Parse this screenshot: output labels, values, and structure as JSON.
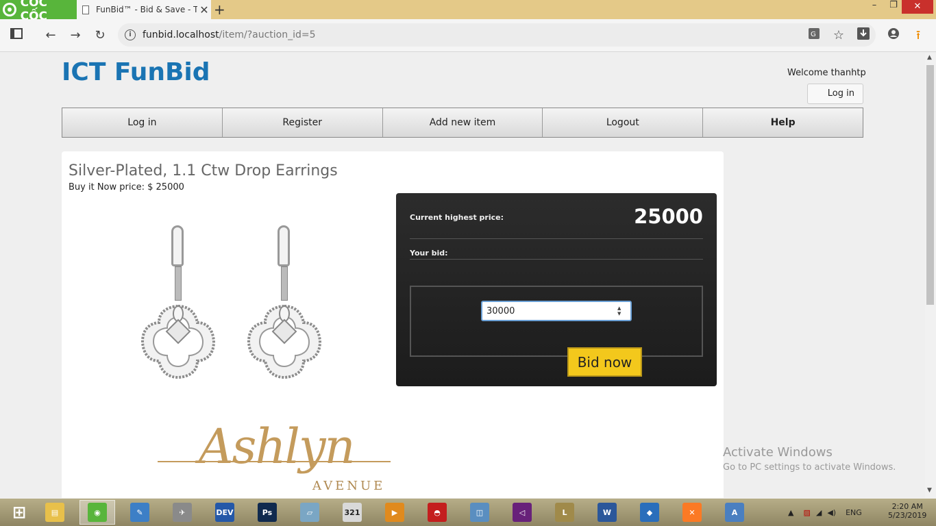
{
  "browser": {
    "brand": "CỐC CỐC",
    "tab_title": "FunBid™ - Bid & Save - Th",
    "tab_close": "✕",
    "new_tab": "+",
    "url_host": "funbid.localhost",
    "url_path": "/item/?auction_id=5",
    "window_controls": {
      "minimize": "–",
      "maximize": "❐",
      "close": "✕"
    }
  },
  "header": {
    "site_title": "ICT FunBid",
    "welcome": "Welcome thanhtp",
    "login_button": "Log in"
  },
  "nav": {
    "items": [
      {
        "label": "Log in"
      },
      {
        "label": "Register"
      },
      {
        "label": "Add new item"
      },
      {
        "label": "Logout"
      },
      {
        "label": "Help"
      }
    ]
  },
  "item": {
    "title": "Silver-Plated, 1.1 Ctw Drop Earrings",
    "buy_now": "Buy it Now price: $ 25000",
    "brand_logo_script": "Ashlyn",
    "brand_logo_sub": "AVENUE"
  },
  "bid_panel": {
    "current_label": "Current highest price:",
    "current_price": "25000",
    "your_bid_label": "Your bid:",
    "bid_value": "30000",
    "bid_button": "Bid now"
  },
  "watermark": {
    "line1": "Activate Windows",
    "line2": "Go to PC settings to activate Windows."
  },
  "taskbar": {
    "apps": [
      {
        "name": "start",
        "glyph": "⊞",
        "color": "#ffffff"
      },
      {
        "name": "file-explorer",
        "glyph": "▤",
        "color": "#e8c04a"
      },
      {
        "name": "coccoc",
        "glyph": "◉",
        "color": "#58b53b"
      },
      {
        "name": "paint",
        "glyph": "✎",
        "color": "#3d7fc6"
      },
      {
        "name": "satellite",
        "glyph": "✈",
        "color": "#8a8a8a"
      },
      {
        "name": "devc",
        "glyph": "DEV",
        "color": "#2458a8"
      },
      {
        "name": "photoshop",
        "glyph": "Ps",
        "color": "#102a4e"
      },
      {
        "name": "notes",
        "glyph": "▱",
        "color": "#7aa6c4"
      },
      {
        "name": "calendar",
        "glyph": "321",
        "color": "#d9d9d9"
      },
      {
        "name": "media",
        "glyph": "▶",
        "color": "#e08a1e"
      },
      {
        "name": "garena",
        "glyph": "◓",
        "color": "#c41e1e"
      },
      {
        "name": "monitor",
        "glyph": "◫",
        "color": "#5a8ec0"
      },
      {
        "name": "visual-studio",
        "glyph": "◁",
        "color": "#68217a"
      },
      {
        "name": "league",
        "glyph": "L",
        "color": "#a08a4a"
      },
      {
        "name": "word",
        "glyph": "W",
        "color": "#2b579a"
      },
      {
        "name": "virtualbox",
        "glyph": "◆",
        "color": "#2a6ebb"
      },
      {
        "name": "xampp",
        "glyph": "✕",
        "color": "#fb7a24"
      },
      {
        "name": "editor",
        "glyph": "A",
        "color": "#4a7fc0"
      }
    ],
    "tray": {
      "language": "ENG"
    },
    "clock": {
      "time": "2:20 AM",
      "date": "5/23/2019"
    }
  }
}
